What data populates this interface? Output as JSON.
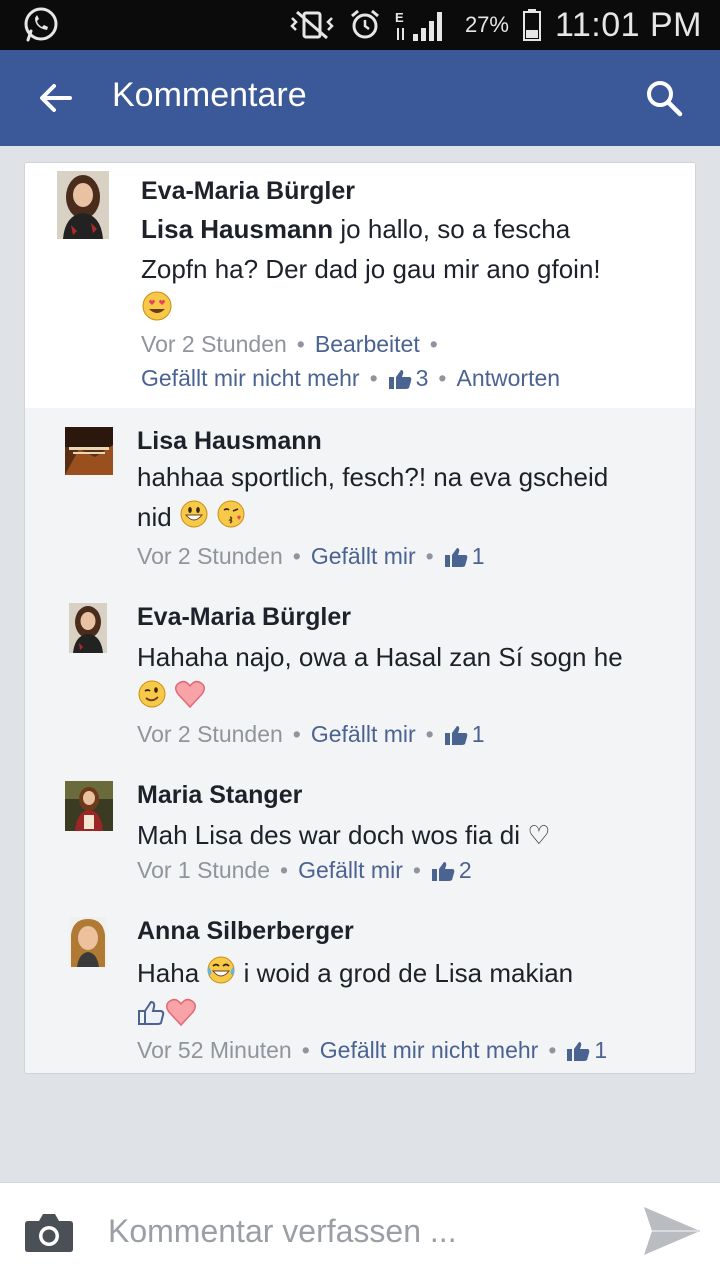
{
  "statusbar": {
    "battery": "27%",
    "time": "11:01 PM"
  },
  "appbar": {
    "title": "Kommentare"
  },
  "main_comment": {
    "author": "Eva-Maria Bürgler",
    "mention": "Lisa Hausmann",
    "text_line1": " jo hallo, so a fescha",
    "text_line2": "Zopfn ha? Der dad jo gau mir ano gfoin!",
    "time": "Vor 2 Stunden",
    "edited": "Bearbeitet",
    "like_action": "Gefällt mir nicht mehr",
    "likes": "3",
    "reply": "Antworten"
  },
  "replies": [
    {
      "author": "Lisa Hausmann",
      "text_line1": "hahhaa sportlich, fesch?! na eva gscheid",
      "text_line2": "nid",
      "time": "Vor 2 Stunden",
      "like_action": "Gefällt mir",
      "likes": "1"
    },
    {
      "author": "Eva-Maria Bürgler",
      "text_line1": "Hahaha najo, owa a Hasal zan Sí sogn he",
      "time": "Vor 2 Stunden",
      "like_action": "Gefällt mir",
      "likes": "1"
    },
    {
      "author": "Maria Stanger",
      "text_line1": "Mah Lisa des war doch wos fia di ♡",
      "time": "Vor 1 Stunde",
      "like_action": "Gefällt mir",
      "likes": "2"
    },
    {
      "author": "Anna Silberberger",
      "text_pre": "Haha ",
      "text_post": " i woid a grod de Lisa makian",
      "time": "Vor 52 Minuten",
      "like_action": "Gefällt mir nicht mehr",
      "likes": "1"
    }
  ],
  "composer": {
    "placeholder": "Kommentar verfassen ..."
  },
  "colors": {
    "appbar": "#3b5998",
    "link": "#4b6391",
    "meta": "#90949c"
  }
}
